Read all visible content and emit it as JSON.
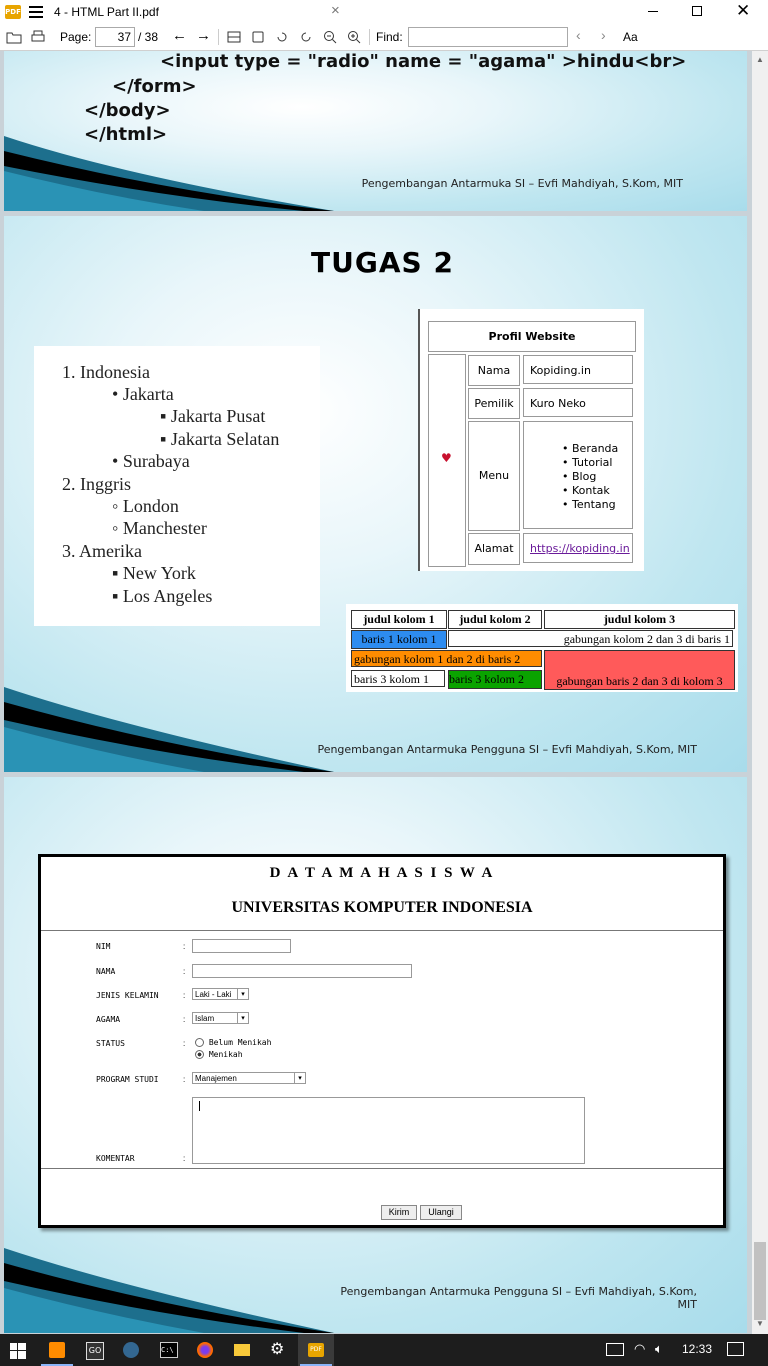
{
  "window": {
    "title": "4 - HTML Part II.pdf",
    "close_tab": "×"
  },
  "toolbar": {
    "page_label": "Page:",
    "page_current": "37",
    "page_total": "/ 38",
    "find_label": "Find:",
    "find_value": "",
    "match_case": "Aa"
  },
  "slide1": {
    "code_lines": [
      "<input type = \"radio\" name = \"agama\" >hindu<br>",
      "</form>",
      "</body>",
      "</html>"
    ],
    "footer": "Pengembangan Antarmuka SI – Evfi Mahdiyah, S.Kom, MIT"
  },
  "slide2": {
    "title": "TUGAS 2",
    "list": {
      "c1": "Indonesia",
      "c1a": "Jakarta",
      "c1a1": "Jakarta Pusat",
      "c1a2": "Jakarta Selatan",
      "c1b": "Surabaya",
      "c2": "Inggris",
      "c2a": "London",
      "c2b": "Manchester",
      "c3": "Amerika",
      "c3a": "New York",
      "c3b": "Los Angeles",
      "n1": "1.",
      "n2": "2.",
      "n3": "3."
    },
    "profile": {
      "header": "Profil Website",
      "nama_label": "Nama",
      "nama_value": "Kopiding.in",
      "pemilik_label": "Pemilik",
      "pemilik_value": "Kuro Neko",
      "menu_label": "Menu",
      "menu_items": [
        "Beranda",
        "Tutorial",
        "Blog",
        "Kontak",
        "Tentang"
      ],
      "alamat_label": "Alamat",
      "alamat_value": "https://kopiding.in"
    },
    "span_table": {
      "h1": "judul kolom 1",
      "h2": "judul kolom 2",
      "h3": "judul kolom 3",
      "r1c1": "baris 1 kolom 1",
      "r1c23": "gabungan kolom 2 dan 3 di baris 1",
      "r2c12": "gabungan kolom 1 dan 2 di baris 2",
      "r23c3": "gabungan baris 2 dan 3 di kolom 3",
      "r3c1": "baris 3 kolom 1",
      "r3c2": "baris 3 kolom 2",
      "colors": {
        "blue": "#2d8cf0",
        "orange": "#ff8c00",
        "green": "#0aa300",
        "red": "#ff5a5a"
      }
    },
    "footer": "Pengembangan Antarmuka Pengguna SI – Evfi Mahdiyah, S.Kom, MIT"
  },
  "slide3": {
    "form_title": "D A T A M A H A S I S W A",
    "form_subtitle": "UNIVERSITAS KOMPUTER INDONESIA",
    "fields": {
      "nim": "NIM",
      "nama": "NAMA",
      "jk": "JENIS KELAMIN",
      "agama": "AGAMA",
      "status": "STATUS",
      "prodi": "PROGRAM STUDI",
      "komentar": "KOMENTAR",
      "colon": ":"
    },
    "values": {
      "jk": "Laki - Laki",
      "agama": "Islam",
      "prodi": "Manajemen",
      "status_opt1": "Belum Menikah",
      "status_opt2": "Menikah"
    },
    "buttons": {
      "kirim": "Kirim",
      "ulangi": "Ulangi"
    },
    "footer_line1": "Pengembangan Antarmuka Pengguna SI – Evfi Mahdiyah, S.Kom,",
    "footer_line2": "MIT"
  },
  "taskbar": {
    "clock": "12:33"
  }
}
